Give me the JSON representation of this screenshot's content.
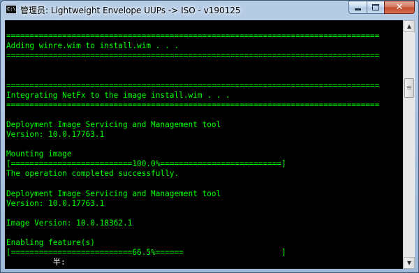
{
  "window": {
    "title": "管理员: Lightweight Envelope UUPs -> ISO - v190125",
    "icon_text": "C:\\.",
    "icon_name": "console-app-icon"
  },
  "controls": {
    "minimize": "minimize-icon",
    "maximize": "maximize-icon",
    "close": "close-icon",
    "close_glyph": "✕"
  },
  "scrollbar": {
    "up_glyph": "▲",
    "down_glyph": "▼"
  },
  "console": {
    "text_color": "#00ff00",
    "background": "#000000",
    "lines": [
      "",
      "================================================================================",
      "Adding winre.wim to install.wim . . .",
      "================================================================================",
      "",
      "",
      "================================================================================",
      "Integrating NetFx to the image install.wim . . .",
      "================================================================================",
      "",
      "Deployment Image Servicing and Management tool",
      "Version: 10.0.17763.1",
      "",
      "Mounting image",
      "[==========================100.0%==========================]",
      "The operation completed successfully.",
      "",
      "Deployment Image Servicing and Management tool",
      "Version: 10.0.17763.1",
      "",
      "Image Version: 10.0.18362.1",
      "",
      "Enabling feature(s)",
      "[==========================66.5%======                     ]"
    ],
    "ime_indicator": "          半:"
  }
}
